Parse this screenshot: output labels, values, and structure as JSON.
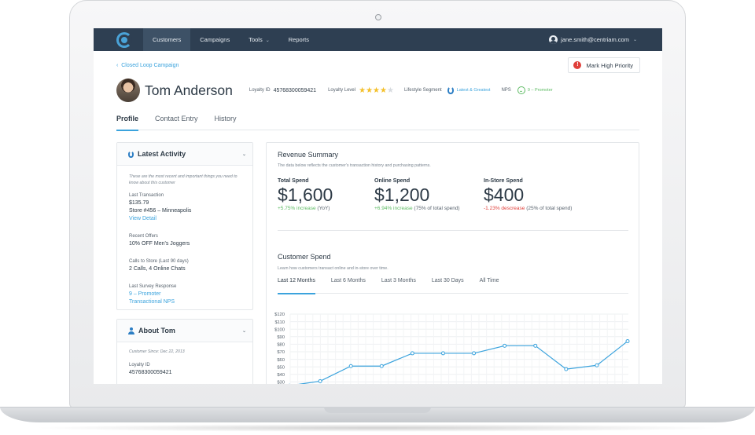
{
  "nav": {
    "items": [
      {
        "label": "Customers",
        "active": true
      },
      {
        "label": "Campaigns",
        "active": false
      },
      {
        "label": "Tools",
        "active": false,
        "has_dropdown": true
      },
      {
        "label": "Reports",
        "active": false
      }
    ],
    "user_email": "jane.smith@centriam.com"
  },
  "breadcrumb": "Closed Loop Campaign",
  "mark_high_priority": "Mark High Priority",
  "customer": {
    "name": "Tom Anderson",
    "loyalty_id_label": "Loyalty ID",
    "loyalty_id": "45768300059421",
    "loyalty_level_label": "Loyalty Level",
    "loyalty_level_stars": 4,
    "loyalty_level_max": 5,
    "lifestyle_segment_label": "Lifestyle Segment",
    "lifestyle_segment": "Latest & Greatest",
    "nps_label": "NPS",
    "nps_value": "9 – Promoter"
  },
  "tabs": [
    {
      "label": "Profile",
      "active": true
    },
    {
      "label": "Contact Entry",
      "active": false
    },
    {
      "label": "History",
      "active": false
    }
  ],
  "latest_activity": {
    "title": "Latest Activity",
    "note": "These are the most recent and important things you need to know about this customer",
    "last_transaction_label": "Last Transaction",
    "last_transaction_amount": "$135.79",
    "last_transaction_store": "Store #456 – Minneapolis",
    "view_detail": "View Detail",
    "recent_offers_label": "Recent Offers",
    "recent_offers": "10% OFF Men's Joggers",
    "calls_label": "Calls to Store (Last 90 days)",
    "calls": "2 Calls, 4 Online Chats",
    "survey_label": "Last Survey Response",
    "survey_value": "9 – Promoter",
    "survey_type": "Transactional NPS"
  },
  "about": {
    "title": "About Tom",
    "since": "Customer Since: Dec 22, 2013",
    "loyalty_id_label": "Loyalty ID",
    "loyalty_id": "45768300059421"
  },
  "revenue": {
    "title": "Revenue Summary",
    "subtitle": "The data below reflects the customer's transaction history and purchasing patterns.",
    "kpis": [
      {
        "label": "Total Spend",
        "value": "$1,600",
        "delta": "+5.75% increase",
        "delta_dir": "up",
        "note": "(YoY)"
      },
      {
        "label": "Online Spend",
        "value": "$1,200",
        "delta": "+6.94% increase",
        "delta_dir": "up",
        "note": "(75% of total spend)"
      },
      {
        "label": "In-Store Spend",
        "value": "$400",
        "delta": "-1.23% descrease",
        "delta_dir": "down",
        "note": "(25% of total spend)"
      }
    ]
  },
  "customer_spend": {
    "title": "Customer Spend",
    "subtitle": "Learn how customers transact online and in-store over time.",
    "ranges": [
      {
        "label": "Last 12 Months",
        "active": true
      },
      {
        "label": "Last 6 Months",
        "active": false
      },
      {
        "label": "Last 3 Months",
        "active": false
      },
      {
        "label": "Last 30 Days",
        "active": false
      },
      {
        "label": "All Time",
        "active": false
      }
    ]
  },
  "colors": {
    "nav_bg": "#2e3f52",
    "accent": "#3ba3dd",
    "positive": "#5dbb63",
    "negative": "#e0403b",
    "star": "#f4c02b"
  },
  "chart_data": {
    "type": "line",
    "y_ticks": [
      "$120",
      "$110",
      "$100",
      "$90",
      "$80",
      "$70",
      "$60",
      "$50",
      "$40",
      "$30"
    ],
    "ylim": [
      30,
      120
    ],
    "grid": true,
    "series": [
      {
        "values": [
          25,
          31,
          51,
          51,
          68,
          68,
          68,
          78,
          78,
          47,
          52,
          84
        ]
      }
    ]
  }
}
